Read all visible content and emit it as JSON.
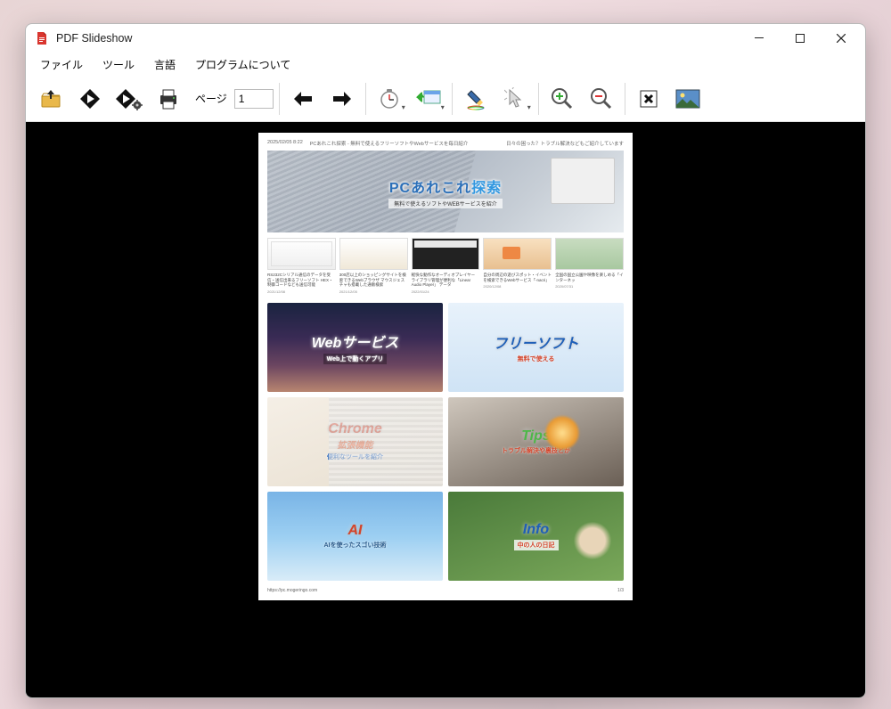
{
  "window": {
    "title": "PDF Slideshow"
  },
  "menu": {
    "file": "ファイル",
    "tools": "ツール",
    "language": "言語",
    "about": "プログラムについて"
  },
  "toolbar": {
    "page_label": "ページ",
    "page_value": "1"
  },
  "doc": {
    "timestamp": "2025/02/05 8:22",
    "header_mid": "PCあれこれ探索 - 無料で使えるフリーソフトやWebサービスを毎日紹介",
    "header_right": "日々の困った？トラブル解決などもご紹介しています",
    "banner": {
      "title_a": "PCあれこれ",
      "title_b": "探索",
      "subtitle": "無料で使えるソフトやWEBサービスを紹介"
    },
    "articles": [
      {
        "title": "RS232Cシリアル通信のデータを受信・送信出来るフリーソフト HEX・制御コードなども送信可能",
        "date": "2021/12/08"
      },
      {
        "title": "300店以上のショッピングサイトを検索できるWebブラウザ マウスジェスチャも搭載した通販検索",
        "date": "2021/12/05"
      },
      {
        "title": "軽快な動作なオーディオプレイヤー ライブラリ管理が便利な「Linear Audio Player」 データ",
        "date": "2022/01/24"
      },
      {
        "title": "自分の周辺の遊びスポット・イベントを検索できるWebサービス「-nacri」",
        "date": "2020/12/08"
      },
      {
        "title": "全国の国立公園や映像を楽しめる「インターネッ",
        "date": "2020/07/31"
      }
    ],
    "tiles": [
      {
        "t1": "Webサービス",
        "t2": "Web上で動くアプリ"
      },
      {
        "t1": "フリーソフト",
        "t2": "無料で使える"
      },
      {
        "t1": "Chrome",
        "t1b": "拡張機能",
        "t2": "便利なツールを紹介"
      },
      {
        "t1": "Tips",
        "t2": "トラブル解決や裏技とか"
      },
      {
        "t1": "AI",
        "t2": "AIを使ったスゴい技術"
      },
      {
        "t1": "Info",
        "t2": "中の人の日記"
      }
    ],
    "footer_url": "https://pc.mogeringo.com",
    "footer_page": "1/3"
  }
}
